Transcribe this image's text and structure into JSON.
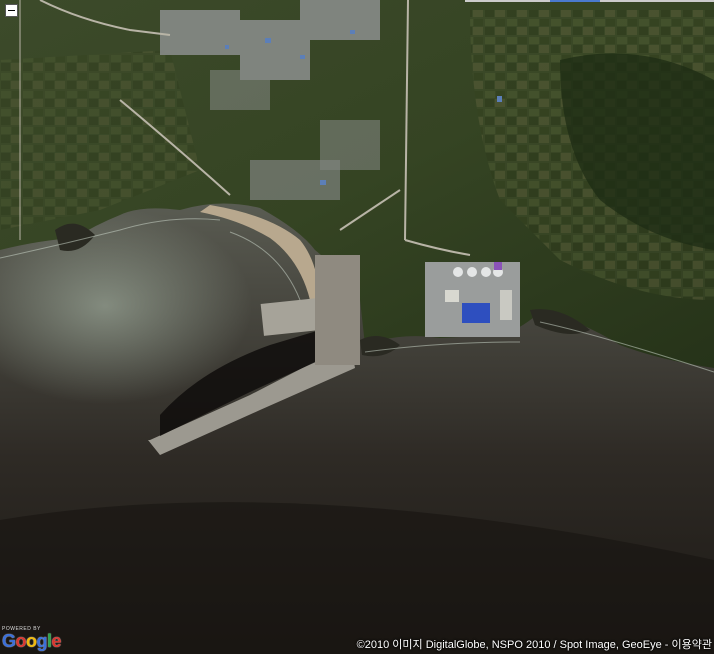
{
  "map": {
    "type": "satellite",
    "features": [
      "coastal-village",
      "harbor-breakwater",
      "power-plant",
      "farmland",
      "forest",
      "sea"
    ]
  },
  "controls": {
    "collapse_icon": "minus-icon",
    "collapse_symbol": "−"
  },
  "branding": {
    "powered_by": "POWERED BY",
    "logo_letters": [
      "G",
      "o",
      "o",
      "g",
      "l",
      "e"
    ],
    "logo_colors": [
      "#3b6fd9",
      "#d9362f",
      "#f1b90c",
      "#3b6fd9",
      "#2aa44a",
      "#d9362f"
    ]
  },
  "attribution": {
    "text": "©2010 이미지 DigitalGlobe, NSPO 2010 / Spot Image, GeoEye -",
    "terms_link": "이용약관"
  }
}
